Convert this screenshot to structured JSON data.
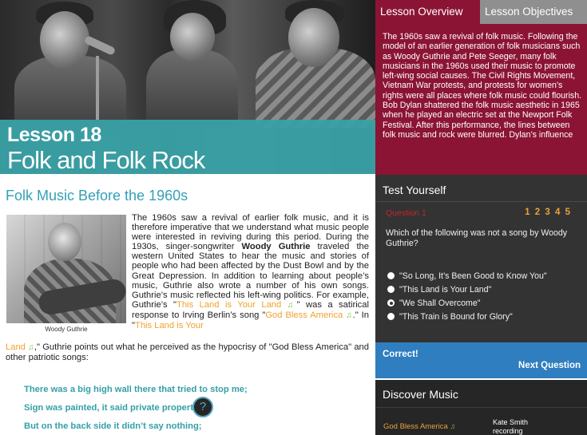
{
  "lesson": {
    "number_label": "Lesson 18",
    "title": "Folk and Folk Rock"
  },
  "article": {
    "heading": "Folk Music Before the 1960s",
    "photo_caption": "Woody Guthrie",
    "para_a1": "The 1960s saw a revival of earlier folk music, and it is therefore imperative that we understand what music people were interested in reviving during this period. During the 1930s, singer-songwriter ",
    "para_a_bold": "Woody Guthrie",
    "para_a2": " traveled the western United States to hear the music and stories of people who had been affected by the Dust Bowl and by the Great Depression. In addition to learning about people’s music, Guthrie also wrote a number of his own songs. Guthrie’s music reflected his left-wing politics. For example, Guthrie’s \"",
    "link_this_land": "This Land is Your Land",
    "para_a3": "\" was a satirical response to Irving Berlin’s song \"",
    "link_god_bless": "God Bless America",
    "para_a4": ".\" In \"",
    "link_this_land_2a": "This Land is Your",
    "link_this_land_2b": "Land",
    "para_b": ",\" Guthrie points out what he perceived as the hypocrisy of \"God Bless America\" and other patriotic songs:",
    "note_glyph": "♫",
    "lyrics": [
      "There was a big high wall there that tried to stop me;",
      "Sign was painted, it said private property;",
      "But on the back side it didn’t say nothing;"
    ]
  },
  "tabs": {
    "overview": "Lesson Overview",
    "objectives": "Lesson Objectives"
  },
  "overview_text": "The 1960s saw a revival of folk music. Following the model of an earlier generation of folk musicians such as Woody Guthrie and Pete Seeger, many folk musicians in the 1960s used their music to promote left-wing social causes. The Civil Rights Movement, Vietnam War protests, and protests for women’s rights were all places where folk music could flourish. Bob Dylan shattered the folk music aesthetic in 1965 when he played an electric set at the Newport Folk Festival. After this performance, the lines between folk music and rock were blurred. Dylan’s influence",
  "test": {
    "title": "Test Yourself",
    "question_label": "Question 1",
    "question_numbers": [
      "1",
      "2",
      "3",
      "4",
      "5"
    ],
    "question_text": "Which of the following was not a song by Woody Guthrie?",
    "options": [
      {
        "label": "\"So Long, It’s Been Good to Know You\"",
        "selected": false
      },
      {
        "label": "\"This Land is Your Land\"",
        "selected": false
      },
      {
        "label": "\"We Shall Overcome\"",
        "selected": true
      },
      {
        "label": "\"This Train is Bound for Glory\"",
        "selected": false
      }
    ]
  },
  "feedback": {
    "result": "Correct!",
    "next": "Next Question"
  },
  "discover": {
    "title": "Discover Music",
    "song": "God Bless America",
    "artist_line1": "Kate Smith",
    "artist_line2": "recording",
    "help_glyph": "?"
  },
  "colors": {
    "teal_band": "#39a0a6",
    "heading": "#35a0b6",
    "overview_bg": "#8b1434",
    "link_orange": "#f0a22c",
    "note_green": "#7bbf2f",
    "correct_blue": "#2f7ec0"
  }
}
